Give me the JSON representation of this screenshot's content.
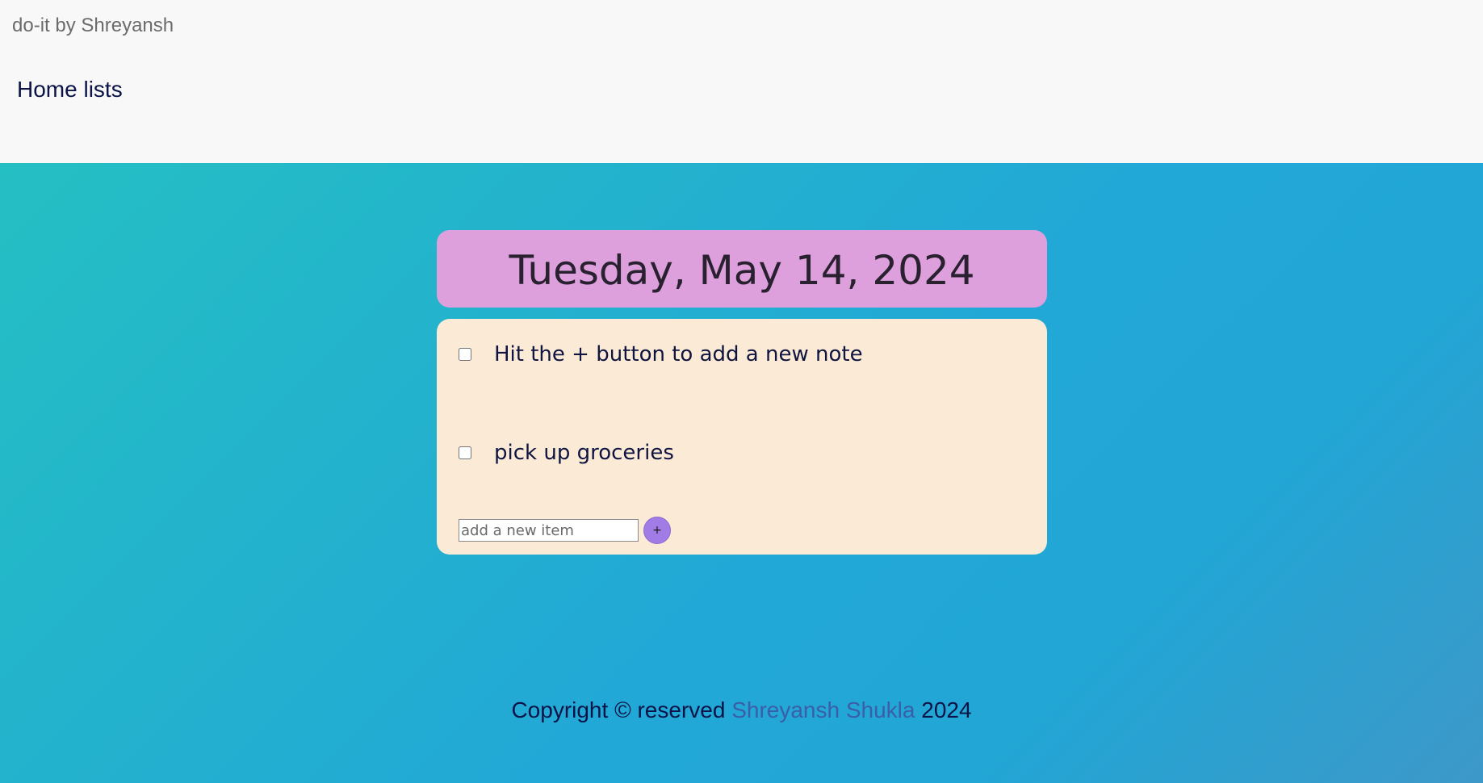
{
  "header": {
    "brand": "do-it by Shreyansh",
    "nav_link": "Home lists"
  },
  "date_card": {
    "date": "Tuesday, May 14, 2024"
  },
  "list": {
    "items": [
      {
        "label": "Hit the + button to add a new note",
        "checked": false
      },
      {
        "label": "pick up groceries",
        "checked": false
      }
    ],
    "add_form": {
      "placeholder": "add a new item",
      "button_label": "+"
    }
  },
  "footer": {
    "prefix": "Copyright © reserved",
    "owner": "Shreyansh Shukla",
    "year": "2024"
  },
  "colors": {
    "header_bg": "#f8f8f8",
    "date_card_bg": "#dda0dd",
    "list_card_bg": "#fbebd6",
    "add_button_bg": "#a17ce6",
    "gradient_start": "#24bfc3",
    "gradient_end": "#3d98c8",
    "owner_link": "#3a5fa8"
  }
}
